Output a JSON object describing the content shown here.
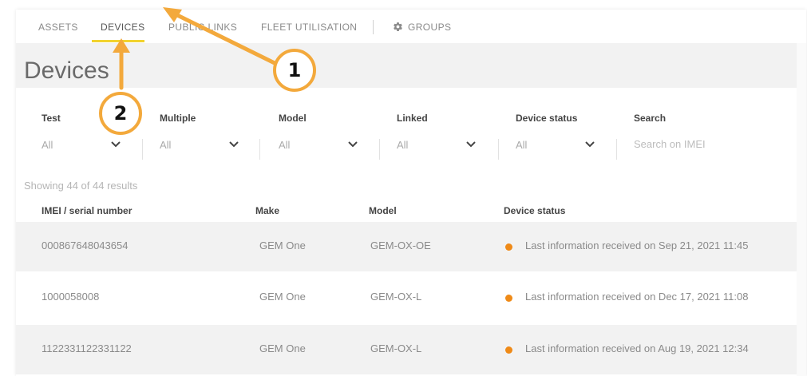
{
  "tabs": [
    {
      "label": "ASSETS"
    },
    {
      "label": "DEVICES"
    },
    {
      "label": "PUBLIC LINKS"
    },
    {
      "label": "FLEET UTILISATION"
    },
    {
      "label": "GROUPS"
    }
  ],
  "page_title": "Devices",
  "filters": [
    {
      "label": "Test",
      "value": "All"
    },
    {
      "label": "Multiple",
      "value": "All"
    },
    {
      "label": "Model",
      "value": "All"
    },
    {
      "label": "Linked",
      "value": "All"
    },
    {
      "label": "Device status",
      "value": "All"
    }
  ],
  "search": {
    "label": "Search",
    "placeholder": "Search on IMEI"
  },
  "results_count": "Showing 44 of 44 results",
  "columns": [
    "IMEI / serial number",
    "Make",
    "Model",
    "Device status"
  ],
  "rows": [
    {
      "imei": "000867648043654",
      "make": "GEM One",
      "model": "GEM-OX-OE",
      "status": "Last information received on Sep 21, 2021 11:45"
    },
    {
      "imei": "1000058008",
      "make": "GEM One",
      "model": "GEM-OX-L",
      "status": "Last information received on Dec 17, 2021 11:08"
    },
    {
      "imei": "1122331122331122",
      "make": "GEM One",
      "model": "GEM-OX-L",
      "status": "Last information received on Aug 19, 2021 12:34"
    }
  ],
  "annotations": [
    {
      "label": "1"
    },
    {
      "label": "2"
    }
  ],
  "colors": {
    "active_tab_underline": "#f2d32e",
    "status_dot": "#ef8a17",
    "annotation": "#f3a93c"
  },
  "icons": {
    "groups_tab": "gear-icon",
    "filter_dropdown": "chevron-down-icon"
  }
}
